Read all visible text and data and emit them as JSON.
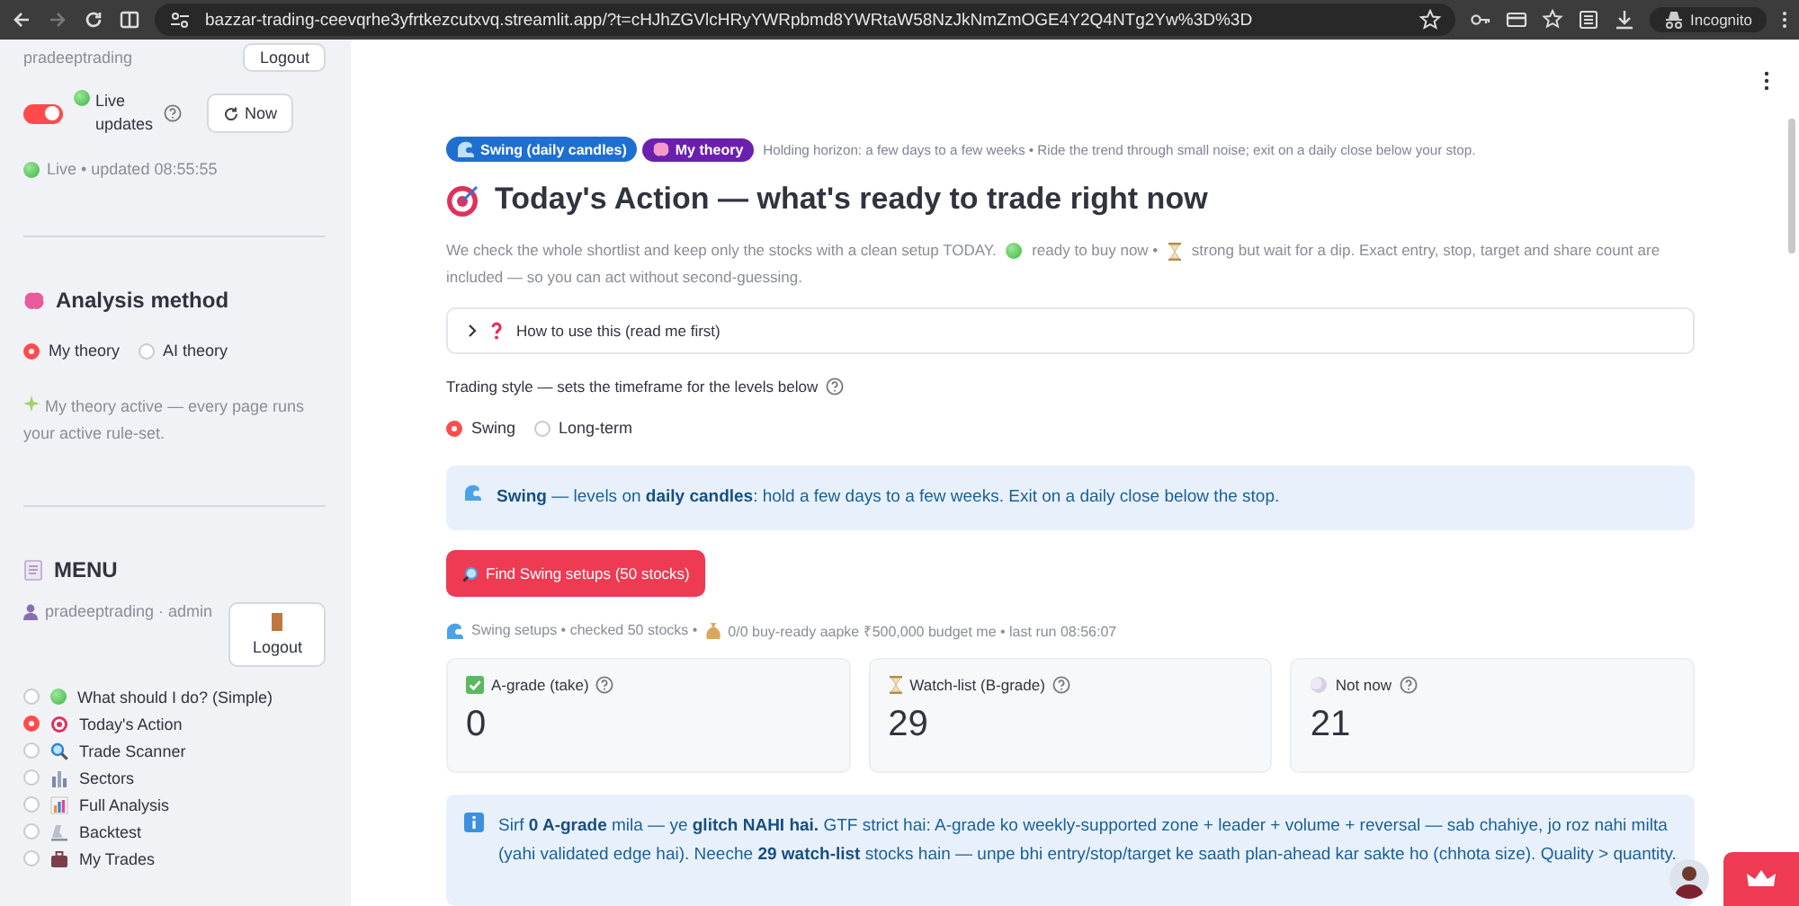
{
  "browser": {
    "url": "bazzar-trading-ceevqrhe3yfrtkezcutxvq.streamlit.app/?t=cHJhZGVlcHRyYWRpbmd8YWRtaW58NzJkNmZmOGE4Y2Q4NTg2Yw%3D%3D",
    "forward_disabled": true,
    "profile": "Incognito"
  },
  "sidebar": {
    "top_user": "pradeeptrading",
    "top_logout": "Logout",
    "live_toggle": {
      "label": "Live updates",
      "on": true
    },
    "now_button": "Now",
    "live_status": "Live • updated 08:55:55",
    "analysis": {
      "title": "Analysis method",
      "options": [
        {
          "label": "My theory",
          "selected": true
        },
        {
          "label": "AI theory",
          "selected": false
        }
      ],
      "note": "My theory active — every page runs your active rule-set."
    },
    "menu": {
      "title": "MENU",
      "user": "pradeeptrading · admin",
      "logout": "Logout",
      "items": [
        {
          "label": "What should I do? (Simple)",
          "kind": "dot",
          "selected": false
        },
        {
          "label": "Today's Action",
          "kind": "target",
          "selected": true
        },
        {
          "label": "Trade Scanner",
          "kind": "search",
          "selected": false
        },
        {
          "label": "Sectors",
          "kind": "bars",
          "selected": false
        },
        {
          "label": "Full Analysis",
          "kind": "chart",
          "selected": false
        },
        {
          "label": "Backtest",
          "kind": "flask",
          "selected": false
        },
        {
          "label": "My Trades",
          "kind": "briefcase",
          "selected": false
        }
      ]
    }
  },
  "main": {
    "tags": [
      {
        "label": "Swing (daily candles)",
        "color": "#1f6fd1"
      },
      {
        "label": "My theory",
        "color": "#6b1fae"
      }
    ],
    "horizon": "Holding horizon: a few days to a few weeks • Ride the trend through small noise; exit on a daily close below your stop.",
    "title": "Today's Action — what's ready to trade right now",
    "description": [
      {
        "kind": "text",
        "text": "We check the whole shortlist and keep only the stocks with a clean setup TODAY."
      },
      {
        "kind": "dot"
      },
      {
        "kind": "text",
        "text": "ready to buy now •"
      },
      {
        "kind": "hourglass"
      },
      {
        "kind": "text",
        "text": "strong but wait for a dip. Exact entry, stop, target and share count are included — so you can act without second-guessing."
      }
    ],
    "expander": {
      "label": "How to use this (read me first)",
      "expanded": false
    },
    "trading_style": {
      "label": "Trading style — sets the timeframe for the levels below",
      "options": [
        {
          "label": "Swing",
          "selected": true
        },
        {
          "label": "Long-term",
          "selected": false
        }
      ]
    },
    "swing_info": "**Swing** — levels on **daily candles**: hold a few days to a few weeks. Exit on a daily close below the stop.",
    "find_button": "Find Swing setups (50 stocks)",
    "caption": [
      "Swing setups • checked 50 stocks •",
      "0/0 buy-ready aapke ₹500,000 budget me • last run 08:56:07"
    ],
    "metrics": [
      {
        "kind": "check",
        "label": "A-grade (take)",
        "value": "0"
      },
      {
        "kind": "hourglass",
        "label": "Watch-list (B-grade)",
        "value": "29"
      },
      {
        "kind": "moon",
        "label": "Not now",
        "value": "21"
      }
    ],
    "note": "Sirf **0 A-grade** mila — ye **glitch NAHI hai.** GTF strict hai: A-grade ko weekly-supported zone + leader + volume + reversal — sab chahiye, jo roz nahi milta (yahi validated edge hai). Neeche **29 watch-list** stocks hain — unpe bhi entry/stop/target ke saath plan-ahead kar sakte ho (chhota size). Quality > quantity."
  }
}
